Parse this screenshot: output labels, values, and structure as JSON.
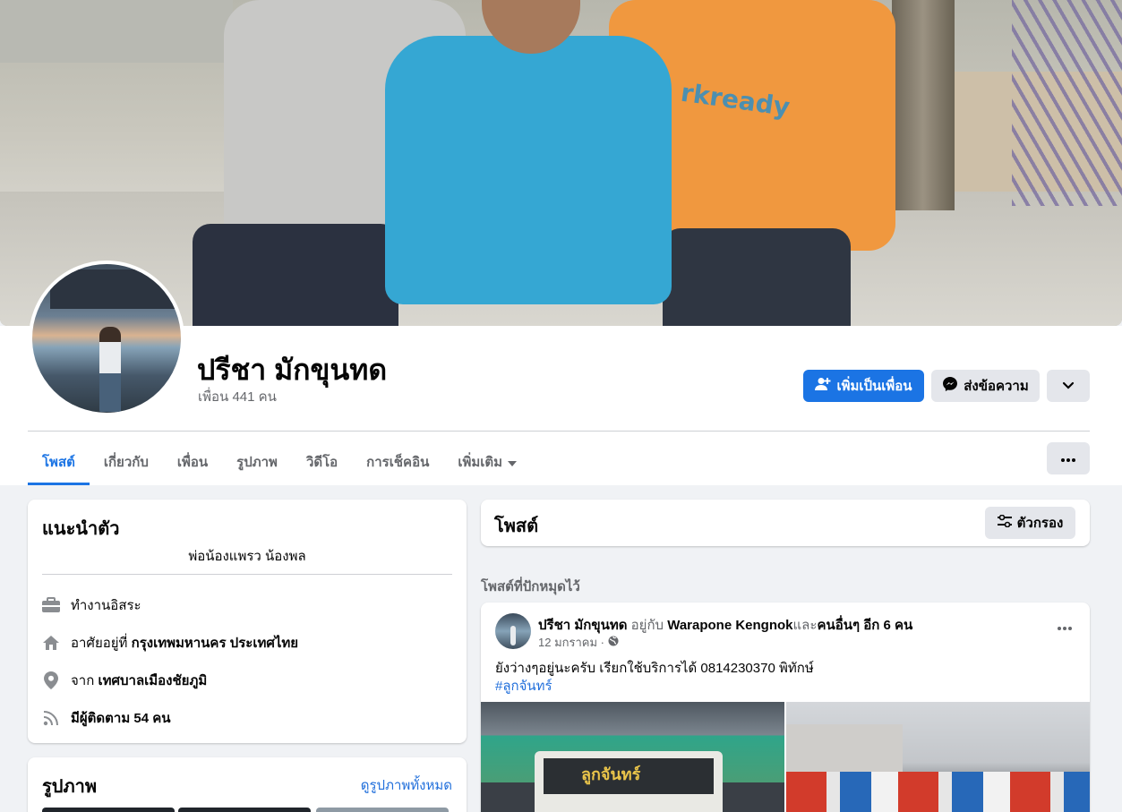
{
  "profile": {
    "name": "ปรีชา มักขุนทด",
    "friends": "เพื่อน 441 คน"
  },
  "actions": {
    "add_friend": "เพิ่มเป็นเพื่อน",
    "message": "ส่งข้อความ"
  },
  "tabs": [
    {
      "label": "โพสต์"
    },
    {
      "label": "เกี่ยวกับ"
    },
    {
      "label": "เพื่อน"
    },
    {
      "label": "รูปภาพ"
    },
    {
      "label": "วิดีโอ"
    },
    {
      "label": "การเช็คอิน"
    },
    {
      "label": "เพิ่มเติม"
    }
  ],
  "intro": {
    "title": "แนะนำตัว",
    "bio": "พ่อน้องแพรว น้องพล",
    "work": "ทำงานอิสระ",
    "lives_prefix": "อาศัยอยู่ที่",
    "lives_value": "กรุงเทพมหานคร ประเทศไทย",
    "from_prefix": "จาก",
    "from_value": "เทศบาลเมืองชัยภูมิ",
    "followers": "มีผู้ติดตาม 54 คน"
  },
  "photos": {
    "title": "รูปภาพ",
    "see_all": "ดูรูปภาพทั้งหมด"
  },
  "posts": {
    "title": "โพสต์",
    "filter": "ตัวกรอง",
    "pinned": "โพสต์ที่ปักหมุดไว้"
  },
  "post": {
    "author": "ปรีชา มักขุนทด",
    "with_text": "อยู่กับ",
    "with_name": "Warapone Kengnok",
    "and_text": "และ",
    "others": "คนอื่นๆ อีก 6 คน",
    "date": "12 มกราคม ·",
    "text": "ยังว่างๆอยู่นะครับ เรียกใช้บริการได้ 0814230370 พิทักษ์",
    "hashtag": "#ลูกจันทร์",
    "image_label": "ลูกจันทร์"
  },
  "cover_text": "rkready",
  "colors": {
    "accent": "#1b74e4",
    "link": "#216fdb",
    "muted": "#65676b"
  }
}
